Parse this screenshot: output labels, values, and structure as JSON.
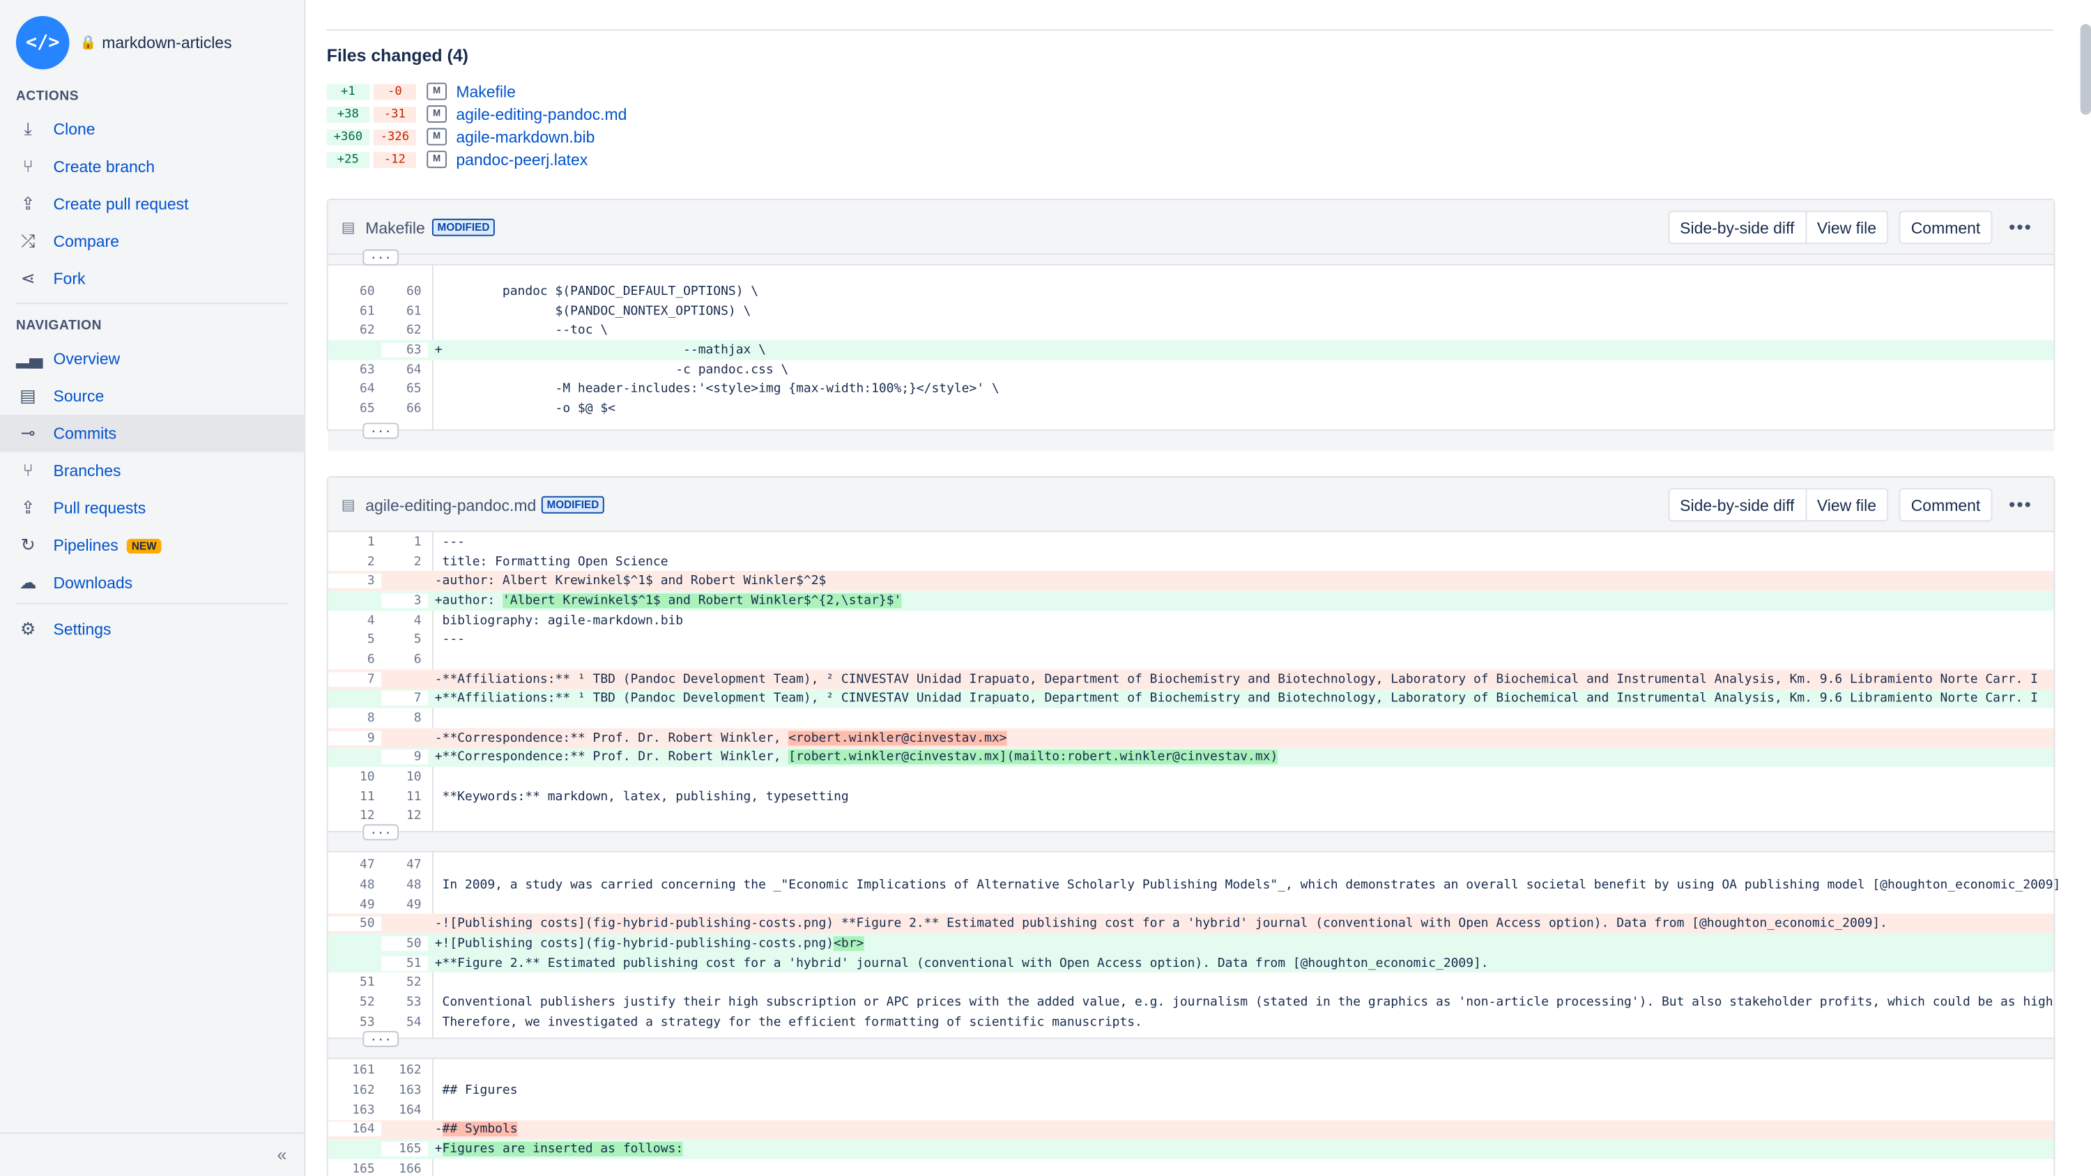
{
  "repo": {
    "name": "markdown-articles",
    "avatar_glyph": "</>"
  },
  "sidebar": {
    "actions_title": "ACTIONS",
    "actions": [
      {
        "label": "Clone",
        "icon": "download-icon"
      },
      {
        "label": "Create branch",
        "icon": "branch-icon"
      },
      {
        "label": "Create pull request",
        "icon": "pull-request-icon"
      },
      {
        "label": "Compare",
        "icon": "shuffle-icon"
      },
      {
        "label": "Fork",
        "icon": "fork-icon"
      }
    ],
    "navigation_title": "NAVIGATION",
    "navigation": [
      {
        "label": "Overview",
        "icon": "chart-icon"
      },
      {
        "label": "Source",
        "icon": "document-icon"
      },
      {
        "label": "Commits",
        "icon": "commit-icon",
        "active": true
      },
      {
        "label": "Branches",
        "icon": "branch-icon"
      },
      {
        "label": "Pull requests",
        "icon": "pull-request-icon"
      },
      {
        "label": "Pipelines",
        "icon": "pipeline-icon",
        "badge": "NEW"
      },
      {
        "label": "Downloads",
        "icon": "cloud-icon"
      }
    ],
    "settings": {
      "label": "Settings",
      "icon": "gear-icon"
    },
    "collapse": "«"
  },
  "files_changed": {
    "title": "Files changed (4)",
    "items": [
      {
        "add": "+1",
        "del": "-0",
        "mark": "M",
        "name": "Makefile"
      },
      {
        "add": "+38",
        "del": "-31",
        "mark": "M",
        "name": "agile-editing-pandoc.md"
      },
      {
        "add": "+360",
        "del": "-326",
        "mark": "M",
        "name": "agile-markdown.bib"
      },
      {
        "add": "+25",
        "del": "-12",
        "mark": "M",
        "name": "pandoc-peerj.latex"
      }
    ]
  },
  "buttons": {
    "side": "Side-by-side diff",
    "view": "View file",
    "comment": "Comment",
    "more": "•••",
    "hunk": "..."
  },
  "files": [
    {
      "name": "Makefile",
      "badge": "MODIFIED",
      "lines": [
        {
          "o": "60",
          "n": "60",
          "t": "         pandoc $(PANDOC_DEFAULT_OPTIONS) \\",
          "k": "c"
        },
        {
          "o": "61",
          "n": "61",
          "t": "                $(PANDOC_NONTEX_OPTIONS) \\",
          "k": "c"
        },
        {
          "o": "62",
          "n": "62",
          "t": "                --toc \\",
          "k": "c"
        },
        {
          "o": "",
          "n": "63",
          "t": "+                                --mathjax \\",
          "k": "a"
        },
        {
          "o": "63",
          "n": "64",
          "t": "                                -c pandoc.css \\",
          "k": "c"
        },
        {
          "o": "64",
          "n": "65",
          "t": "                -M header-includes:'<style>img {max-width:100%;}</style>' \\",
          "k": "c"
        },
        {
          "o": "65",
          "n": "66",
          "t": "                -o $@ $<",
          "k": "c"
        }
      ]
    },
    {
      "name": "agile-editing-pandoc.md",
      "badge": "MODIFIED",
      "hunk1": [
        {
          "o": "1",
          "n": "1",
          "t": " ---",
          "k": "c"
        },
        {
          "o": "2",
          "n": "2",
          "t": " title: Formatting Open Science",
          "k": "c"
        },
        {
          "o": "3",
          "n": "",
          "t": "-author: Albert Krewinkel$^1$ and Robert Winkler$^2$",
          "k": "d"
        },
        {
          "o": "",
          "n": "3",
          "t": "+author: ",
          "k": "a",
          "h": "'Albert Krewinkel$^1$ and Robert Winkler$^{2,\\star}$'"
        },
        {
          "o": "4",
          "n": "4",
          "t": " bibliography: agile-markdown.bib",
          "k": "c"
        },
        {
          "o": "5",
          "n": "5",
          "t": " ---",
          "k": "c"
        },
        {
          "o": "6",
          "n": "6",
          "t": "",
          "k": "c"
        },
        {
          "o": "7",
          "n": "",
          "t": "-**Affiliations:** ¹ TBD (Pandoc Development Team), ² CINVESTAV Unidad Irapuato, Department of Biochemistry and Biotechnology, Laboratory of Biochemical and Instrumental Analysis, Km. 9.6 Libramiento Norte Carr. I",
          "k": "d"
        },
        {
          "o": "",
          "n": "7",
          "t": "+**Affiliations:** ¹ TBD (Pandoc Development Team), ² CINVESTAV Unidad Irapuato, Department of Biochemistry and Biotechnology, Laboratory of Biochemical and Instrumental Analysis, Km. 9.6 Libramiento Norte Carr. I",
          "k": "a"
        },
        {
          "o": "8",
          "n": "8",
          "t": "",
          "k": "c"
        },
        {
          "o": "9",
          "n": "",
          "t": "-**Correspondence:** Prof. Dr. Robert Winkler, ",
          "k": "d",
          "h": "<robert.winkler@cinvestav.mx>"
        },
        {
          "o": "",
          "n": "9",
          "t": "+**Correspondence:** Prof. Dr. Robert Winkler, ",
          "k": "a",
          "h": "[robert.winkler@cinvestav.mx](mailto:robert.winkler@cinvestav.mx)"
        },
        {
          "o": "10",
          "n": "10",
          "t": "",
          "k": "c"
        },
        {
          "o": "11",
          "n": "11",
          "t": " **Keywords:** markdown, latex, publishing, typesetting",
          "k": "c"
        },
        {
          "o": "12",
          "n": "12",
          "t": "",
          "k": "c"
        }
      ],
      "hunk2": [
        {
          "o": "47",
          "n": "47",
          "t": "",
          "k": "c"
        },
        {
          "o": "48",
          "n": "48",
          "t": " In 2009, a study was carried concerning the _\"Economic Implications of Alternative Scholarly Publishing Models\"_, which demonstrates an overall societal benefit by using OA publishing model [@houghton_economic_2009]",
          "k": "c"
        },
        {
          "o": "49",
          "n": "49",
          "t": "",
          "k": "c"
        },
        {
          "o": "50",
          "n": "",
          "t": "-![Publishing costs](fig-hybrid-publishing-costs.png) **Figure 2.** Estimated publishing cost for a 'hybrid' journal (conventional with Open Access option). Data from [@houghton_economic_2009].",
          "k": "d"
        },
        {
          "o": "",
          "n": "50",
          "t": "+![Publishing costs](fig-hybrid-publishing-costs.png)",
          "k": "a",
          "h": "<br>"
        },
        {
          "o": "",
          "n": "51",
          "t": "+**Figure 2.** Estimated publishing cost for a 'hybrid' journal (conventional with Open Access option). Data from [@houghton_economic_2009].",
          "k": "a"
        },
        {
          "o": "51",
          "n": "52",
          "t": "",
          "k": "c"
        },
        {
          "o": "52",
          "n": "53",
          "t": " Conventional publishers justify their high subscription or APC prices with the added value, e.g. journalism (stated in the graphics as 'non-article processing'). But also stakeholder profits, which could be as high",
          "k": "c"
        },
        {
          "o": "53",
          "n": "54",
          "t": " Therefore, we investigated a strategy for the efficient formatting of scientific manuscripts.",
          "k": "c"
        }
      ],
      "hunk3": [
        {
          "o": "161",
          "n": "162",
          "t": "",
          "k": "c"
        },
        {
          "o": "162",
          "n": "163",
          "t": " ## Figures",
          "k": "c"
        },
        {
          "o": "163",
          "n": "164",
          "t": "",
          "k": "c"
        },
        {
          "o": "164",
          "n": "",
          "t": "-",
          "k": "d",
          "h": "## Symbols"
        },
        {
          "o": "",
          "n": "165",
          "t": "+",
          "k": "a",
          "h": "Figures are inserted as follows:"
        },
        {
          "o": "165",
          "n": "166",
          "t": "",
          "k": "c"
        }
      ]
    }
  ]
}
